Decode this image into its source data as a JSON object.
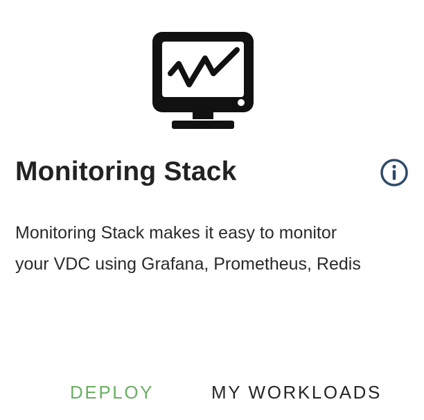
{
  "card": {
    "icon": "monitor-chart-icon",
    "title": "Monitoring Stack",
    "info_icon": "info-icon",
    "description_lines": [
      "Monitoring Stack makes it easy to monitor",
      "your VDC using Grafana, Prometheus, Redis"
    ],
    "actions": {
      "deploy_label": "DEPLOY",
      "workloads_label": "MY WORKLOADS"
    }
  },
  "colors": {
    "deploy": "#6aaf62",
    "info_icon": "#2e4a6b",
    "icon": "#111111"
  }
}
